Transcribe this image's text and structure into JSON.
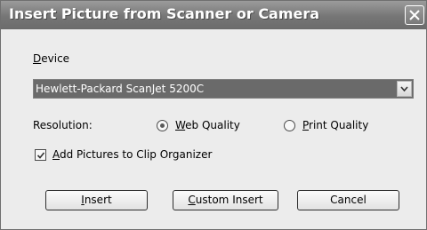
{
  "window": {
    "title": "Insert Picture from Scanner or Camera"
  },
  "device": {
    "label_hotkey": "D",
    "label_rest": "evice",
    "selected": "Hewlett-Packard ScanJet 5200C"
  },
  "resolution": {
    "label": "Resolution:",
    "options": [
      {
        "hotkey": "W",
        "rest": "eb Quality",
        "selected": true
      },
      {
        "hotkey": "P",
        "rest": "rint Quality",
        "selected": false
      }
    ]
  },
  "clip_organizer": {
    "hotkey": "A",
    "rest": "dd Pictures to Clip Organizer",
    "checked": true
  },
  "buttons": {
    "insert_hotkey": "I",
    "insert_rest": "nsert",
    "custom_hotkey": "C",
    "custom_rest": "ustom Insert",
    "cancel": "Cancel"
  },
  "icons": {
    "close": "close-icon",
    "dropdown": "chevron-down-icon",
    "check": "check-icon"
  }
}
